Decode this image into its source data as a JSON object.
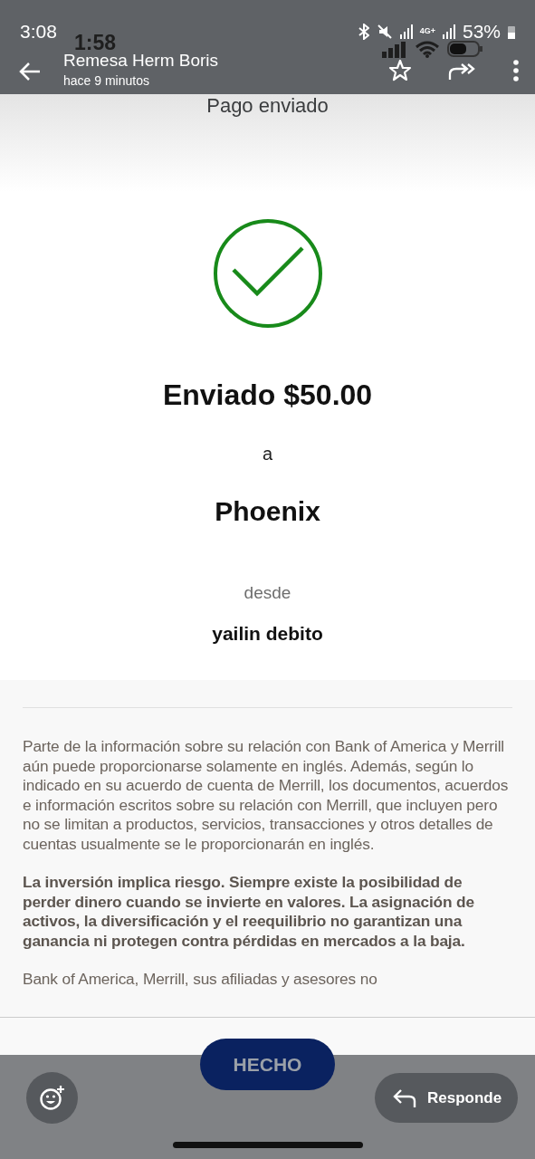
{
  "status_bar": {
    "time": "3:08",
    "network_type": "4G+",
    "battery": "53%"
  },
  "inner_status_bar": {
    "time": "1:58"
  },
  "viewer_bar": {
    "title": "Remesa Herm Boris",
    "subtitle": "hace 9 minutos"
  },
  "screen": {
    "title": "Pago enviado",
    "amount_line": "Enviado $50.00",
    "to_label": "a",
    "recipient": "Phoenix",
    "from_label": "desde",
    "account": "yailin debito",
    "paragraphs": [
      {
        "text": "Parte de la información sobre su relación con Bank of America y Merrill aún puede proporcionarse solamente en inglés. Además, según lo indicado en su acuerdo de cuenta de Merrill, los documentos, acuerdos e información escritos sobre su relación con Merrill, que incluyen pero no se limitan a productos, servicios, transacciones y otros detalles de cuentas usualmente se le proporcionarán en inglés.",
        "bold": false
      },
      {
        "text": "La inversión implica riesgo. Siempre existe la posibilidad de perder dinero cuando se invierte en valores. La asignación de activos, la diversificación y el reequilibrio no garantizan una ganancia ni protegen contra pérdidas en mercados a la baja.",
        "bold": true
      },
      {
        "text": "Bank of America, Merrill, sus afiliadas y asesores no",
        "bold": false
      }
    ],
    "button": "HECHO"
  },
  "reply_button": "Responde"
}
